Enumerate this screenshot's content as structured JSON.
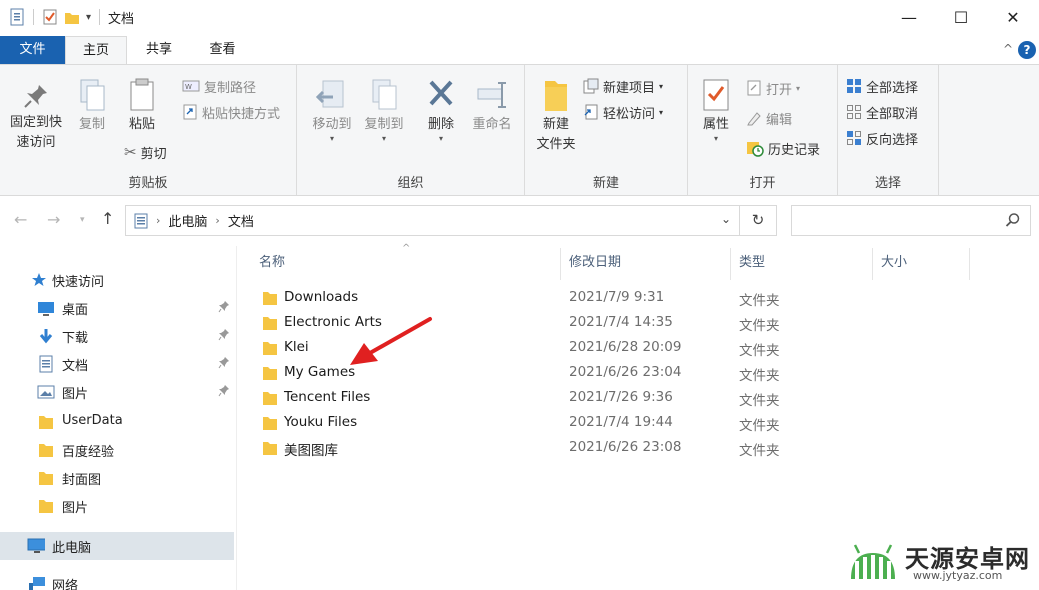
{
  "window": {
    "title": "文档",
    "minimize_glyph": "—",
    "maximize_glyph": "☐",
    "close_glyph": "✕"
  },
  "tabs": {
    "file": "文件",
    "home": "主页",
    "share": "共享",
    "view": "查看",
    "help": "?"
  },
  "ribbon": {
    "clipboard": {
      "label": "剪贴板",
      "pin_quick_access": [
        "固定到快",
        "速访问"
      ],
      "copy": "复制",
      "paste": "粘贴",
      "cut": "剪切",
      "copy_path": "复制路径",
      "paste_shortcut": "粘贴快捷方式"
    },
    "organize": {
      "label": "组织",
      "move_to": "移动到",
      "copy_to": "复制到",
      "delete": "删除",
      "rename": "重命名"
    },
    "new": {
      "label": "新建",
      "new_folder": [
        "新建",
        "文件夹"
      ],
      "new_item": "新建项目",
      "easy_access": "轻松访问"
    },
    "open": {
      "label": "打开",
      "properties": "属性",
      "open": "打开",
      "edit": "编辑",
      "history": "历史记录"
    },
    "select": {
      "label": "选择",
      "select_all": "全部选择",
      "select_none": "全部取消",
      "invert": "反向选择"
    }
  },
  "address": {
    "crumbs": [
      "此电脑",
      "文档"
    ],
    "search_placeholder": ""
  },
  "nav_pane": {
    "quick_access": "快速访问",
    "pinned": [
      "桌面",
      "下载",
      "文档",
      "图片"
    ],
    "folders": [
      "UserData",
      "百度经验",
      "封面图",
      "图片"
    ],
    "this_pc": "此电脑",
    "network": "网络"
  },
  "columns": {
    "name": "名称",
    "modified": "修改日期",
    "type": "类型",
    "size": "大小"
  },
  "files": [
    {
      "name": "Downloads",
      "modified": "2021/7/9 9:31",
      "type": "文件夹"
    },
    {
      "name": "Electronic Arts",
      "modified": "2021/7/4 14:35",
      "type": "文件夹"
    },
    {
      "name": "Klei",
      "modified": "2021/6/28 20:09",
      "type": "文件夹"
    },
    {
      "name": "My Games",
      "modified": "2021/6/26 23:04",
      "type": "文件夹"
    },
    {
      "name": "Tencent Files",
      "modified": "2021/7/26 9:36",
      "type": "文件夹"
    },
    {
      "name": "Youku Files",
      "modified": "2021/7/4 19:44",
      "type": "文件夹"
    },
    {
      "name": "美图图库",
      "modified": "2021/6/26 23:08",
      "type": "文件夹"
    }
  ],
  "watermark": {
    "title": "天源安卓网",
    "url": "www.jytyaz.com"
  },
  "colors": {
    "accent": "#1a62b0",
    "folder": "#f5c542",
    "selected_nav": "#dde4ea",
    "annotation_arrow": "#e02020"
  }
}
